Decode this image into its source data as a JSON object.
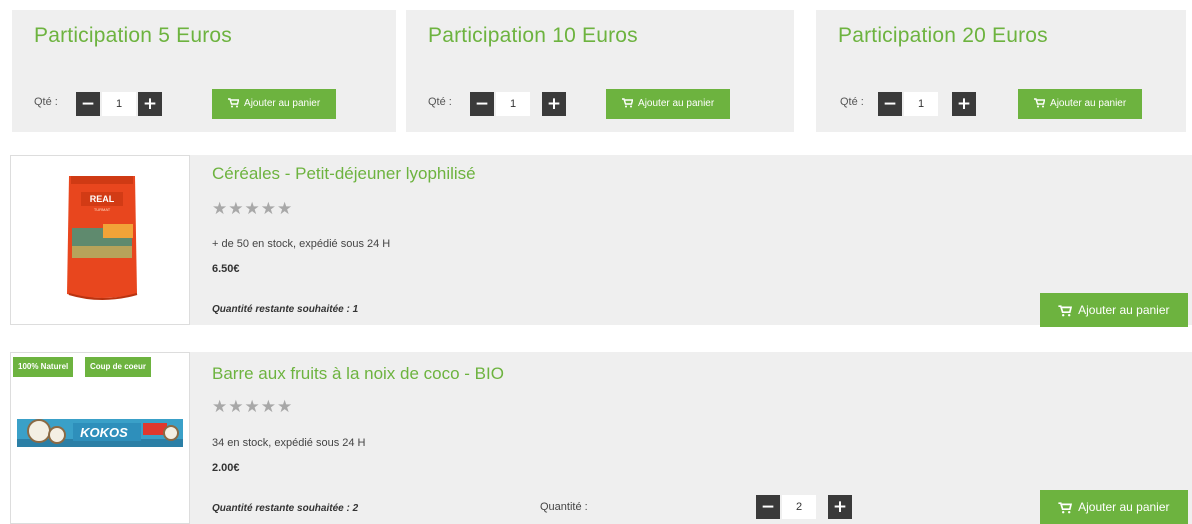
{
  "participations": [
    {
      "title": "Participation 5 Euros",
      "qty_label": "Qté :",
      "minus": "−",
      "qty": "1",
      "plus": "+",
      "cart_label": "Ajouter au panier"
    },
    {
      "title": "Participation 10 Euros",
      "qty_label": "Qté :",
      "minus": "−",
      "qty": "1",
      "plus": "+",
      "cart_label": "Ajouter au panier"
    },
    {
      "title": "Participation 20 Euros",
      "qty_label": "Qté :",
      "minus": "−",
      "qty": "1",
      "plus": "+",
      "cart_label": "Ajouter au panier"
    }
  ],
  "products": [
    {
      "name": "Céréales - Petit-déjeuner lyophilisé",
      "stars": "★★★★★",
      "rating": 0,
      "stock": "+ de 50 en stock, expédié sous 24 H",
      "price": "6.50€",
      "wish": "Quantité restante souhaitée : 1",
      "cart_label": "Ajouter au panier",
      "package_brand": "REAL",
      "package_sub": "TURMAT"
    },
    {
      "name": "Barre aux fruits à la noix de coco - BIO",
      "stars": "★★★★★",
      "rating": 0,
      "stock": "34 en stock, expédié sous 24 H",
      "price": "2.00€",
      "wish": "Quantité restante souhaitée : 2",
      "qty_label": "Quantité :",
      "minus": "−",
      "qty": "2",
      "plus": "+",
      "cart_label": "Ajouter au panier",
      "badges": [
        "100% Naturel",
        "Coup de coeur"
      ],
      "package_brand": "KOKOS"
    }
  ],
  "colors": {
    "accent": "#6db33f",
    "panel": "#efefef",
    "stepper": "#3a3a3a",
    "stars": "#a8a8a8"
  },
  "icons": {
    "cart": "cart-icon",
    "minus": "minus-icon",
    "plus": "plus-icon",
    "star": "star-icon"
  }
}
